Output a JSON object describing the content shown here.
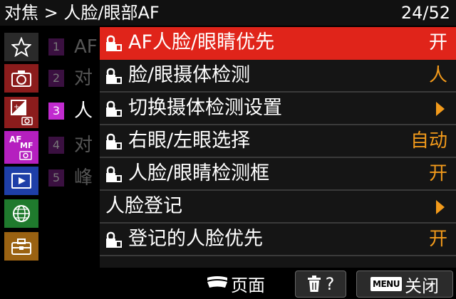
{
  "header": {
    "breadcrumb": "对焦 > 人脸/眼部AF",
    "page_indicator": "24/52"
  },
  "categories": [
    {
      "icon": "star-icon"
    },
    {
      "icon": "camera-icon"
    },
    {
      "icon": "exposure-icon"
    },
    {
      "icon": "af-mf-icon",
      "text_top": "AF",
      "text_sub": "MF"
    },
    {
      "icon": "playback-icon"
    },
    {
      "icon": "network-icon"
    },
    {
      "icon": "toolbox-icon"
    }
  ],
  "subpages": [
    {
      "num": "1",
      "text": "AF"
    },
    {
      "num": "2",
      "text": "对"
    },
    {
      "num": "3",
      "text": "人"
    },
    {
      "num": "4",
      "text": "对"
    },
    {
      "num": "5",
      "text": "峰"
    }
  ],
  "menu": [
    {
      "label": "AF人脸/眼睛优先",
      "value": "开",
      "lock": true,
      "selected": true
    },
    {
      "label": "脸/眼摄体检测",
      "value": "人",
      "lock": true
    },
    {
      "label": "切换摄体检测设置",
      "arrow": true,
      "lock": true
    },
    {
      "label": "右眼/左眼选择",
      "value": "自动",
      "lock": true
    },
    {
      "label": "人脸/眼睛检测框",
      "value": "开",
      "lock": true
    },
    {
      "label": "人脸登记",
      "arrow": true,
      "lock": false
    },
    {
      "label": "登记的人脸优先",
      "value": "开",
      "lock": true
    }
  ],
  "footer": {
    "page_label": "页面",
    "delete_hint": "?",
    "menu_key": "MENU",
    "close_label": "关闭"
  },
  "colors": {
    "selected_row": "#e0241a",
    "value_orange": "#f29a1b",
    "af_category": "#b51fbf"
  }
}
